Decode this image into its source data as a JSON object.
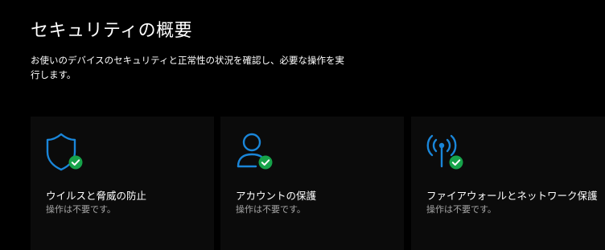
{
  "page": {
    "title": "セキュリティの概要",
    "description": "お使いのデバイスのセキュリティと正常性の状況を確認し、必要な操作を実行します。"
  },
  "tiles": [
    {
      "icon": "shield-icon",
      "title": "ウイルスと脅威の防止",
      "status": "操作は不要です。"
    },
    {
      "icon": "person-icon",
      "title": "アカウントの保護",
      "status": "操作は不要です。"
    },
    {
      "icon": "antenna-icon",
      "title": "ファイアウォールとネットワーク保護",
      "status": "操作は不要です。"
    }
  ],
  "colors": {
    "background": "#000000",
    "tile_background": "#0b0b0b",
    "icon_accent": "#1a86d9",
    "ok_green": "#16a34a",
    "secondary_text": "#a6a6a6"
  }
}
